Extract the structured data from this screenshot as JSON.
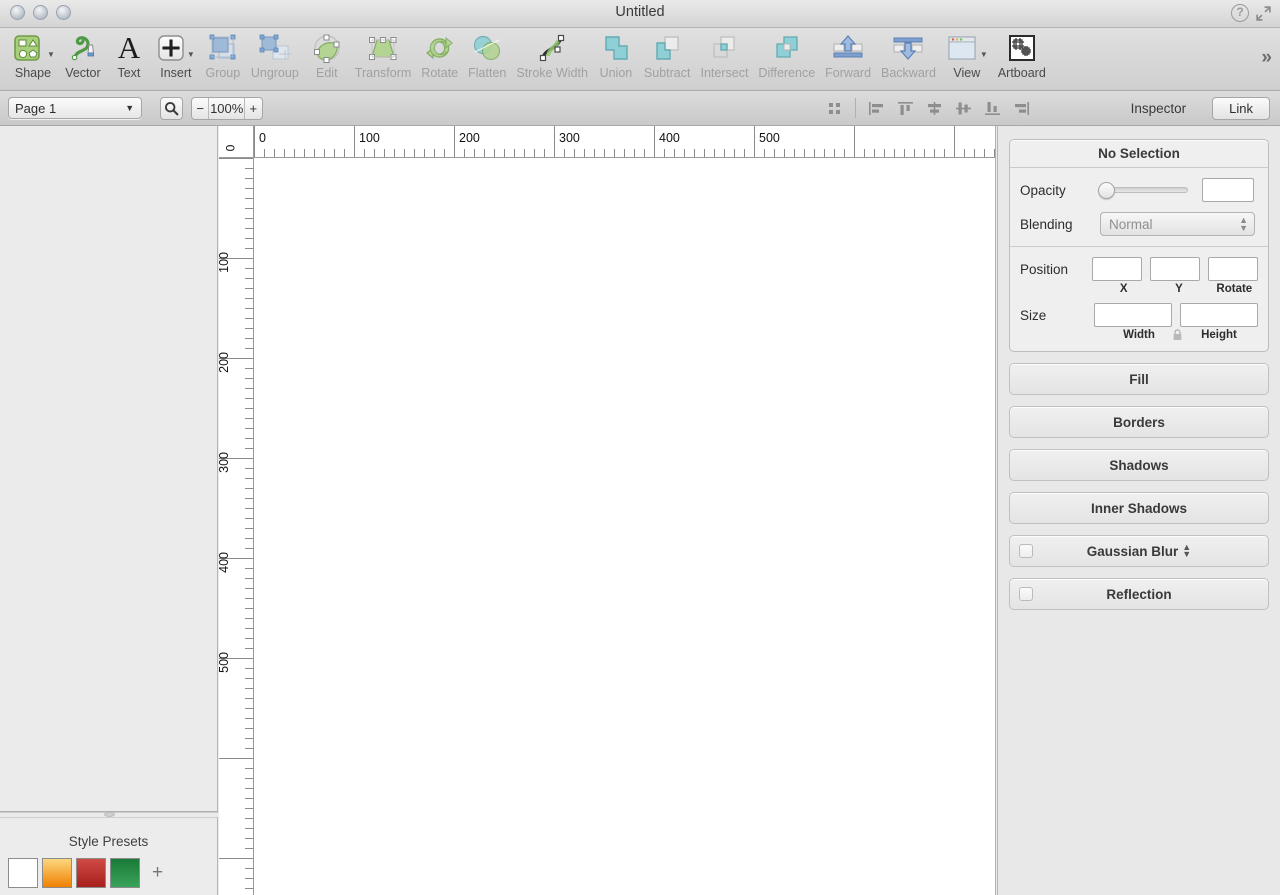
{
  "window": {
    "title": "Untitled",
    "controls": [
      "close",
      "minimize",
      "zoom"
    ],
    "help_icon": "help-icon",
    "expand_icon": "expand-icon"
  },
  "toolbar": {
    "items": [
      {
        "label": "Shape",
        "icon": "shape-icon",
        "enabled": true,
        "dropdown": true
      },
      {
        "label": "Vector",
        "icon": "vector-pen-icon",
        "enabled": true,
        "dropdown": false
      },
      {
        "label": "Text",
        "icon": "text-icon",
        "enabled": true,
        "dropdown": false
      },
      {
        "label": "Insert",
        "icon": "insert-plus-icon",
        "enabled": true,
        "dropdown": true
      },
      {
        "label": "Group",
        "icon": "group-icon",
        "enabled": false,
        "dropdown": false
      },
      {
        "label": "Ungroup",
        "icon": "ungroup-icon",
        "enabled": false,
        "dropdown": false
      },
      {
        "label": "Edit",
        "icon": "edit-icon",
        "enabled": false,
        "dropdown": false
      },
      {
        "label": "Transform",
        "icon": "transform-icon",
        "enabled": false,
        "dropdown": false
      },
      {
        "label": "Rotate",
        "icon": "rotate-icon",
        "enabled": false,
        "dropdown": false
      },
      {
        "label": "Flatten",
        "icon": "flatten-icon",
        "enabled": false,
        "dropdown": false
      },
      {
        "label": "Stroke Width",
        "icon": "stroke-width-icon",
        "enabled": false,
        "dropdown": false
      },
      {
        "label": "Union",
        "icon": "union-icon",
        "enabled": false,
        "dropdown": false
      },
      {
        "label": "Subtract",
        "icon": "subtract-icon",
        "enabled": false,
        "dropdown": false
      },
      {
        "label": "Intersect",
        "icon": "intersect-icon",
        "enabled": false,
        "dropdown": false
      },
      {
        "label": "Difference",
        "icon": "difference-icon",
        "enabled": false,
        "dropdown": false
      },
      {
        "label": "Forward",
        "icon": "forward-icon",
        "enabled": false,
        "dropdown": false
      },
      {
        "label": "Backward",
        "icon": "backward-icon",
        "enabled": false,
        "dropdown": false
      },
      {
        "label": "View",
        "icon": "view-icon",
        "enabled": true,
        "dropdown": true
      },
      {
        "label": "Artboard",
        "icon": "artboard-icon",
        "enabled": true,
        "dropdown": false
      }
    ],
    "overflow_label": "»"
  },
  "optionsbar": {
    "page_value": "Page 1",
    "search_icon": "search-icon",
    "zoom_minus": "−",
    "zoom_value": "100%",
    "zoom_plus": "+",
    "grid_icon": "grid-toggle-icon",
    "align_icons": [
      "align-left-icon",
      "align-top-icon",
      "align-center-horizontal-icon",
      "align-middle-vertical-icon",
      "align-bottom-icon",
      "align-right-icon"
    ],
    "inspector_label": "Inspector",
    "link_label": "Link"
  },
  "rulers": {
    "horizontal_labels": [
      "0",
      "100",
      "200",
      "300",
      "400",
      "500"
    ],
    "vertical_labels": [
      "100",
      "200",
      "300",
      "400",
      "500"
    ],
    "corner_label": "0",
    "major_step": 100,
    "minor_step": 10,
    "unit_scale": 1
  },
  "inspector": {
    "header": "No Selection",
    "opacity": {
      "label": "Opacity",
      "value": "",
      "slider_position": 0
    },
    "blending": {
      "label": "Blending",
      "value": "Normal"
    },
    "position": {
      "label": "Position",
      "x": {
        "label": "X",
        "value": ""
      },
      "y": {
        "label": "Y",
        "value": ""
      },
      "rotate": {
        "label": "Rotate",
        "value": ""
      }
    },
    "size": {
      "label": "Size",
      "width": {
        "label": "Width",
        "value": ""
      },
      "height": {
        "label": "Height",
        "value": ""
      },
      "lock_icon": "lock-icon"
    },
    "sections": [
      {
        "label": "Fill",
        "checkbox": false,
        "stepper": false
      },
      {
        "label": "Borders",
        "checkbox": false,
        "stepper": false
      },
      {
        "label": "Shadows",
        "checkbox": false,
        "stepper": false
      },
      {
        "label": "Inner Shadows",
        "checkbox": false,
        "stepper": false
      },
      {
        "label": "Gaussian Blur",
        "checkbox": true,
        "stepper": true
      },
      {
        "label": "Reflection",
        "checkbox": true,
        "stepper": false
      }
    ]
  },
  "style_presets": {
    "title": "Style Presets",
    "add_label": "+",
    "swatches": [
      {
        "name": "white",
        "colors": [
          "#ffffff",
          "#ffffff"
        ]
      },
      {
        "name": "orange",
        "colors": [
          "#fcd77f",
          "#f08000"
        ]
      },
      {
        "name": "red",
        "colors": [
          "#cf4b46",
          "#a81f1c"
        ]
      },
      {
        "name": "green",
        "colors": [
          "#1a7a38",
          "#3aa35a"
        ]
      }
    ]
  },
  "colors": {
    "accent_green": "#a8cf7c",
    "accent_teal": "#7fc4c4",
    "accent_blue": "#7e9fcf",
    "canvas": "#ffffff",
    "chrome": "#e8e8e8"
  }
}
